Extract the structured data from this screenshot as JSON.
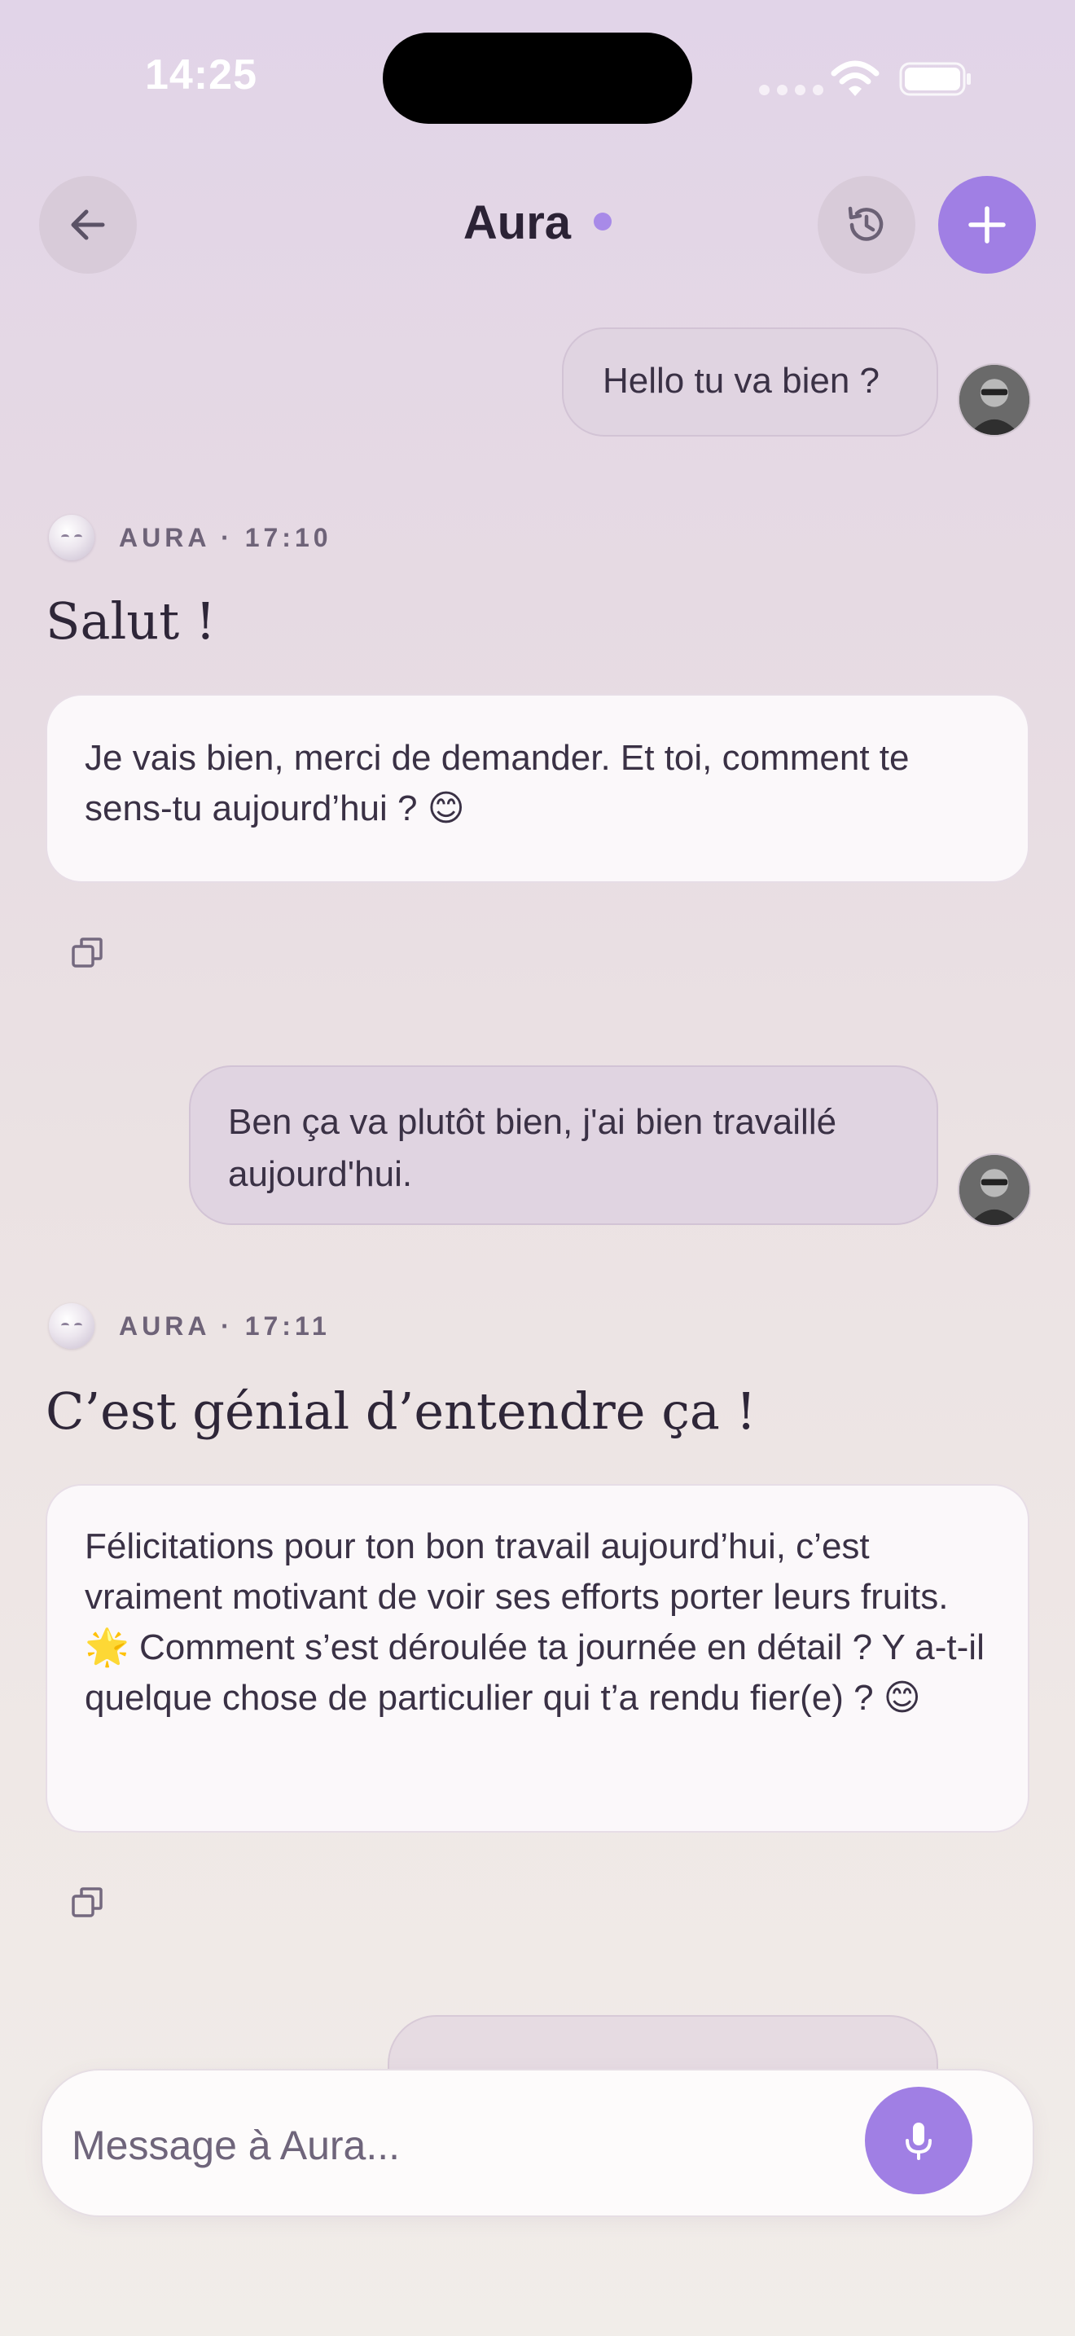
{
  "status_bar": {
    "time": "14:25"
  },
  "header": {
    "title": "Aura"
  },
  "messages": [
    {
      "role": "user",
      "text": "Hello tu va bien ?"
    },
    {
      "role": "aura",
      "meta": "AURA · 17:10",
      "title": "Salut !",
      "body": "Je vais bien, merci de demander. Et toi, comment te sens-tu aujourd’hui ? 😊"
    },
    {
      "role": "user",
      "text": "Ben ça va plutôt bien, j'ai bien travaillé aujourd'hui."
    },
    {
      "role": "aura",
      "meta": "AURA · 17:11",
      "title": "C’est génial d’entendre ça !",
      "body": "Félicitations pour ton bon travail aujourd’hui, c’est vraiment motivant de voir ses efforts porter leurs fruits. 🌟 Comment s’est déroulée ta journée en détail ? Y a-t-il quelque chose de particulier qui t’a rendu fier(e) ? 😊"
    }
  ],
  "composer": {
    "placeholder": "Message à Aura..."
  },
  "colors": {
    "accent": "#a07fe4",
    "user_bubble": "#e0d4e1",
    "card": "#fbf8fa"
  },
  "icons": {
    "back": "arrow-left-icon",
    "history": "history-icon",
    "new_chat": "plus-icon",
    "copy": "copy-icon",
    "mic": "microphone-icon"
  }
}
